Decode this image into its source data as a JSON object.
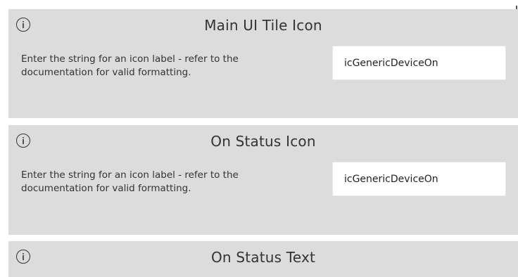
{
  "panels": [
    {
      "title": "Main UI Tile Icon",
      "description": "Enter the string for an icon label - refer to the documentation for valid formatting.",
      "input_value": "icGenericDeviceOn"
    },
    {
      "title": "On Status Icon",
      "description": "Enter the string for an icon label - refer to the documentation for valid formatting.",
      "input_value": "icGenericDeviceOn"
    },
    {
      "title": "On Status Text"
    }
  ],
  "colors": {
    "panel_bg": "#dcdcdc",
    "page_bg": "#ffffff",
    "text": "#333333"
  },
  "icons": {
    "info": "info-circle-icon"
  }
}
